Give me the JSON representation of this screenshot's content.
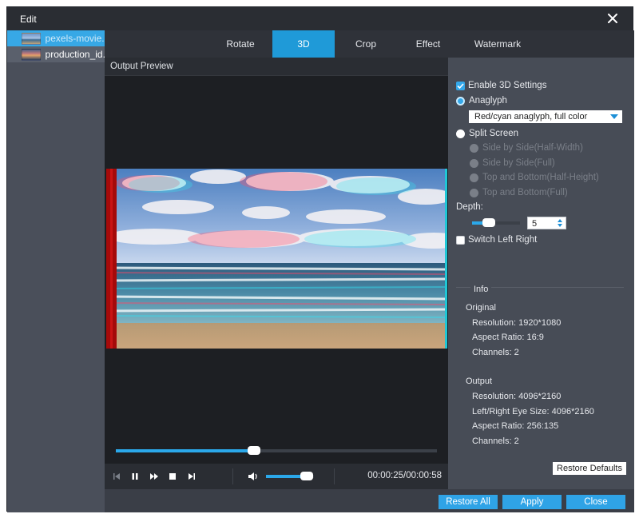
{
  "window": {
    "title": "Edit",
    "close_icon": "close-icon"
  },
  "files": [
    {
      "name": "pexels-movie...",
      "active": true
    },
    {
      "name": "production_id...",
      "active": false
    }
  ],
  "tabs": [
    {
      "label": "Rotate",
      "active": false
    },
    {
      "label": "3D",
      "active": true
    },
    {
      "label": "Crop",
      "active": false
    },
    {
      "label": "Effect",
      "active": false
    },
    {
      "label": "Watermark",
      "active": false
    }
  ],
  "preview": {
    "header": "Output Preview",
    "timeline_progress": 0.43,
    "volume_level": 0.85,
    "timecode": "00:00:25/00:00:58",
    "controls": [
      "skip-back-icon",
      "pause-icon",
      "fast-forward-icon",
      "stop-icon",
      "skip-forward-icon",
      "volume-icon"
    ]
  },
  "settings": {
    "enable_3d": {
      "label": "Enable 3D Settings",
      "checked": true
    },
    "anaglyph": {
      "label": "Anaglyph",
      "selected": true
    },
    "anaglyph_mode": "Red/cyan anaglyph, full color",
    "split_screen": {
      "label": "Split Screen",
      "selected": false
    },
    "split_options": [
      "Side by Side(Half-Width)",
      "Side by Side(Full)",
      "Top and Bottom(Half-Height)",
      "Top and Bottom(Full)"
    ],
    "depth_label": "Depth:",
    "depth_value": "5",
    "depth_level": 0.35,
    "switch_lr": {
      "label": "Switch Left Right",
      "checked": false
    }
  },
  "info": {
    "title": "Info",
    "original_label": "Original",
    "original": [
      "Resolution: 1920*1080",
      "Aspect Ratio: 16:9",
      "Channels: 2"
    ],
    "output_label": "Output",
    "output": [
      "Resolution: 4096*2160",
      "Left/Right Eye Size: 4096*2160",
      "Aspect Ratio: 256:135",
      "Channels: 2"
    ]
  },
  "buttons": {
    "restore_defaults": "Restore Defaults",
    "restore_all": "Restore All",
    "apply": "Apply",
    "close": "Close"
  },
  "colors": {
    "accent": "#2fa3e6",
    "tab_active": "#1f9ad8",
    "panel": "#474c56",
    "dark": "#1d1f23"
  }
}
